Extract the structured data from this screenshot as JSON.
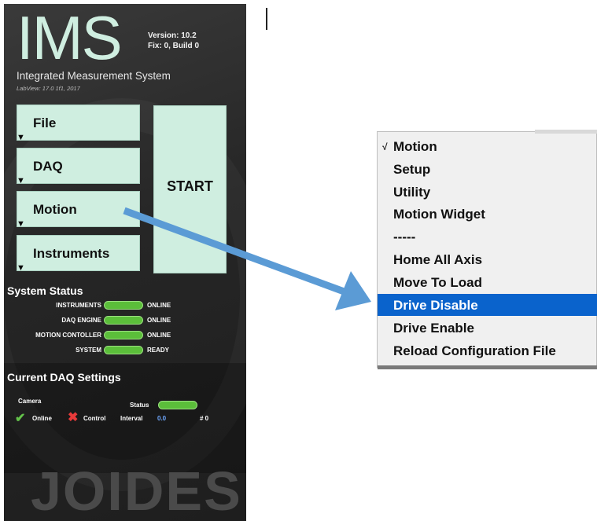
{
  "app": {
    "logo": "IMS",
    "version": "Version: 10.2",
    "build": "Fix: 0, Build 0",
    "subtitle": "Integrated Measurement System",
    "labview": "LabView: 17.0 1f1, 2017",
    "watermark": "JOIDES"
  },
  "nav": [
    {
      "label": "File"
    },
    {
      "label": "DAQ"
    },
    {
      "label": "Motion"
    },
    {
      "label": "Instruments"
    }
  ],
  "start_label": "START",
  "system_status": {
    "title": "System Status",
    "rows": [
      {
        "name": "INSTRUMENTS",
        "value": "ONLINE"
      },
      {
        "name": "DAQ ENGINE",
        "value": "ONLINE"
      },
      {
        "name": "MOTION CONTOLLER",
        "value": "ONLINE"
      },
      {
        "name": "SYSTEM",
        "value": "READY"
      }
    ]
  },
  "daq_settings": {
    "title": "Current DAQ Settings",
    "camera_label": "Camera",
    "status_label": "Status",
    "online_label": "Online",
    "control_label": "Control",
    "interval_label": "Interval",
    "interval_value": "0.0",
    "count_label": "# 0"
  },
  "menu": {
    "items": [
      {
        "label": "Motion",
        "checked": true
      },
      {
        "label": "Setup"
      },
      {
        "label": "Utility"
      },
      {
        "label": "Motion Widget"
      },
      {
        "label": "-----"
      },
      {
        "label": "Home All Axis"
      },
      {
        "label": "Move To Load"
      },
      {
        "label": "Drive Disable",
        "selected": true
      },
      {
        "label": "Drive Enable"
      },
      {
        "label": "Reload Configuration File"
      }
    ],
    "check_glyph": "√"
  },
  "colors": {
    "button_fill": "#cfeee0",
    "status_pill": "#5bbe3a",
    "menu_highlight": "#0a63cc",
    "arrow": "#5b9bd5"
  }
}
